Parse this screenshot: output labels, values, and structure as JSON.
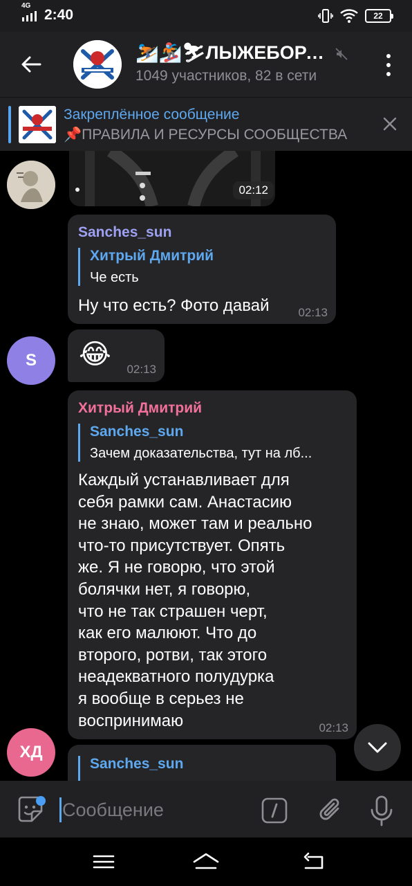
{
  "status_bar": {
    "time": "2:40",
    "network": "4G",
    "battery": "22"
  },
  "header": {
    "title": "⛷️🏂⛷ЛЫЖЕБОРДЕРЫ",
    "subtitle": "1049 участников, 82 в сети"
  },
  "pinned": {
    "title": "Закреплённое сообщение",
    "text": "📌ПРАВИЛА И РЕСУРСЫ СООБЩЕСТВА"
  },
  "messages": [
    {
      "type": "photo",
      "time": "02:12"
    },
    {
      "sender": "Sanches_sun",
      "sender_color": "#9ea1f2",
      "reply": {
        "name": "Хитрый Дмитрий",
        "text": "Че есть"
      },
      "text": "Ну что есть? Фото давай",
      "time": "02:13"
    },
    {
      "avatar_letter": "S",
      "avatar_color": "#8f80e6",
      "text": "😂",
      "time": "02:13"
    },
    {
      "sender": "Хитрый Дмитрий",
      "sender_color": "#f2719a",
      "reply": {
        "name": "Sanches_sun",
        "text": "Зачем доказательства, тут на лб..."
      },
      "text": "Каждый устанавливает для\nсебя рамки сам. Анастасию\nне знаю, может там и реально\nчто-то присутствует. Опять\nже. Я не говорю, что этой\nболячки нет, я говорю,\nчто не так страшен черт,\nкак его малюют. Что до\nвторого, ротви, так этого\nнеадекватного полудурка\nя вообще в серьез не\nвоспринимаю",
      "time": "02:13",
      "avatar_letters": "ХД",
      "avatar_color": "#e9688f"
    },
    {
      "reply": {
        "name": "Sanches_sun"
      }
    }
  ],
  "input": {
    "placeholder": "Сообщение",
    "value": ""
  },
  "colors": {
    "accent": "#5ea8ef",
    "bubble": "#252528",
    "header": "#212124"
  }
}
